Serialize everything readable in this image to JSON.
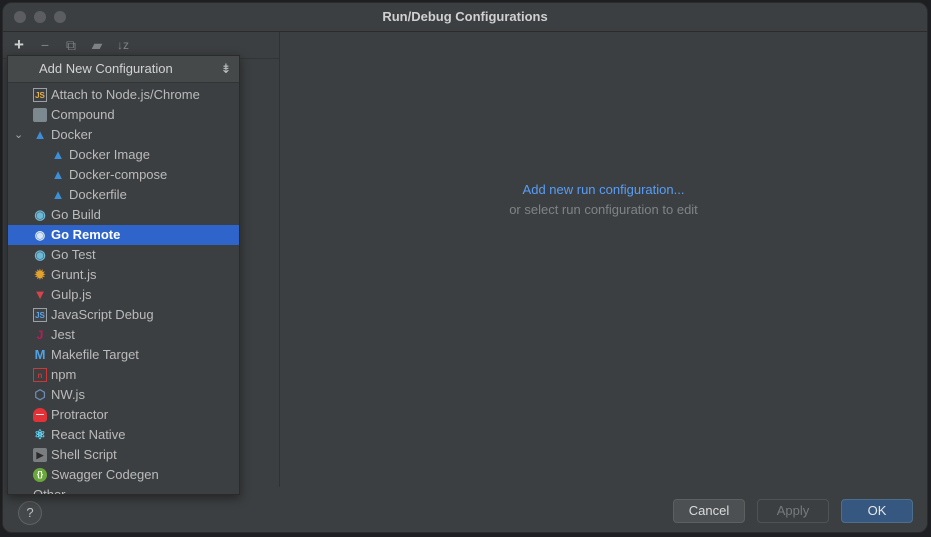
{
  "window": {
    "title": "Run/Debug Configurations"
  },
  "toolbar": {
    "add": "+",
    "remove": "−",
    "copy": "⧉",
    "folder": "▰",
    "sort": "↓z"
  },
  "popup": {
    "title": "Add New Configuration",
    "collapse_icon": "⇟",
    "items": [
      {
        "label": "Attach to Node.js/Chrome",
        "icon": "attach-icon",
        "glyph": "JS",
        "level": 0
      },
      {
        "label": "Compound",
        "icon": "compound-icon",
        "glyph": "",
        "level": 0
      },
      {
        "label": "Docker",
        "icon": "docker-icon",
        "glyph": "▲",
        "level": 0,
        "expanded": true
      },
      {
        "label": "Docker Image",
        "icon": "docker-icon",
        "glyph": "▲",
        "level": 1
      },
      {
        "label": "Docker-compose",
        "icon": "docker-icon",
        "glyph": "▲",
        "level": 1
      },
      {
        "label": "Dockerfile",
        "icon": "docker-icon",
        "glyph": "▲",
        "level": 1
      },
      {
        "label": "Go Build",
        "icon": "gopher-icon",
        "glyph": "◉",
        "level": 0
      },
      {
        "label": "Go Remote",
        "icon": "gopher-remote-icon",
        "glyph": "◉",
        "level": 0,
        "selected": true
      },
      {
        "label": "Go Test",
        "icon": "gopher-test-icon",
        "glyph": "◉",
        "level": 0
      },
      {
        "label": "Grunt.js",
        "icon": "grunt-icon",
        "glyph": "✹",
        "level": 0
      },
      {
        "label": "Gulp.js",
        "icon": "gulp-icon",
        "glyph": "▼",
        "level": 0
      },
      {
        "label": "JavaScript Debug",
        "icon": "javascript-debug-icon",
        "glyph": "JS",
        "level": 0
      },
      {
        "label": "Jest",
        "icon": "jest-icon",
        "glyph": "J",
        "level": 0
      },
      {
        "label": "Makefile Target",
        "icon": "makefile-icon",
        "glyph": "M",
        "level": 0
      },
      {
        "label": "npm",
        "icon": "npm-icon",
        "glyph": "n",
        "level": 0
      },
      {
        "label": "NW.js",
        "icon": "nwjs-icon",
        "glyph": "⬡",
        "level": 0
      },
      {
        "label": "Protractor",
        "icon": "protractor-icon",
        "glyph": "—",
        "level": 0
      },
      {
        "label": "React Native",
        "icon": "react-icon",
        "glyph": "⚛",
        "level": 0
      },
      {
        "label": "Shell Script",
        "icon": "shell-script-icon",
        "glyph": "▶",
        "level": 0
      },
      {
        "label": "Swagger Codegen",
        "icon": "swagger-icon",
        "glyph": "{}",
        "level": 0
      },
      {
        "label": "Other",
        "icon": "",
        "glyph": "",
        "level": 0,
        "expanded": true
      }
    ]
  },
  "main": {
    "add_link": "Add new run configuration...",
    "hint": "or select run configuration to edit"
  },
  "footer": {
    "help": "?",
    "cancel": "Cancel",
    "apply": "Apply",
    "ok": "OK"
  },
  "colors": {
    "accent": "#2f65ca",
    "link": "#589df6",
    "background": "#3c3f41",
    "ok_button": "#365880"
  }
}
